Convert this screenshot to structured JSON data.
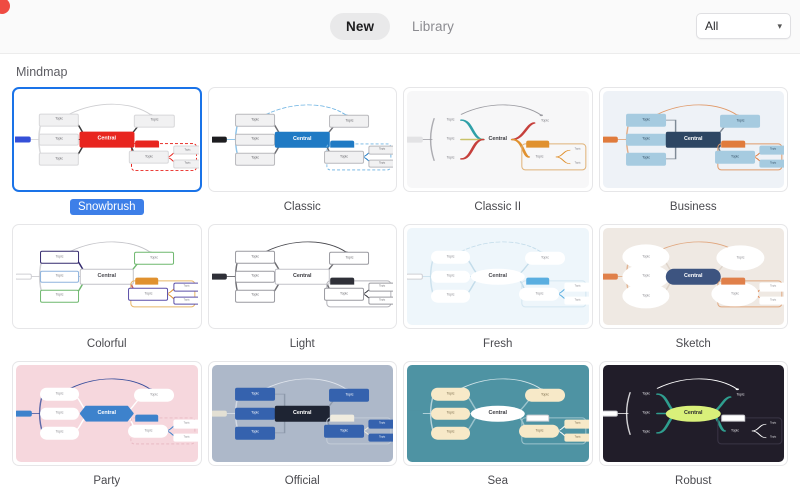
{
  "window": {
    "traffic_light_color": "#ef4b42"
  },
  "header": {
    "tabs": [
      {
        "label": "New",
        "active": true
      },
      {
        "label": "Library",
        "active": false
      }
    ],
    "filter": {
      "value": "All",
      "chevron": "⌄"
    }
  },
  "main": {
    "section_title": "Mindmap",
    "node_labels": {
      "central": "Central",
      "topic": "Topic",
      "sub": "Topic"
    },
    "cards": [
      {
        "name": "Snowbrush",
        "selected": true,
        "bg": "#ffffff",
        "central_bg": "#e8251f",
        "central_fg": "#ffffff",
        "topic_bg": "#f1f1f2",
        "topic_fg": "#6b6b70",
        "topic_border": "#d8d8da",
        "line": "#3a3a3c",
        "accent": "#e8251f",
        "dash": "#cfcfd2",
        "grp_border": "#e8251f",
        "left_chip": "#3550d8"
      },
      {
        "name": "Classic",
        "selected": false,
        "bg": "#ffffff",
        "central_bg": "#1f7ac4",
        "central_fg": "#ffffff",
        "topic_bg": "#f1f1f2",
        "topic_fg": "#5e5e63",
        "topic_border": "#b9b9bd",
        "line": "#6e6e73",
        "accent": "#1f7ac4",
        "dash": "#6fb4e3",
        "grp_border": "#6fb4e3",
        "left_chip": "#1d1d20"
      },
      {
        "name": "Classic II",
        "selected": false,
        "bg": "#f7f7f8",
        "central_bg": "transparent",
        "central_fg": "#3b3b40",
        "topic_bg": "transparent",
        "topic_fg": "#7a7a80",
        "topic_border": "transparent",
        "line": "#9a9aa0",
        "accent": "#e0912f",
        "dash": "#9a9aa0",
        "grp_border": "#e0b277",
        "left_chip": "#e3e3e5",
        "branch_colors": [
          "#2fa0a8",
          "#c9c26a",
          "#c6403c",
          "#e0912f"
        ]
      },
      {
        "name": "Business",
        "selected": false,
        "bg": "#eef2f7",
        "central_bg": "#2d4663",
        "central_fg": "#ffffff",
        "topic_bg": "#a6cbe0",
        "topic_fg": "#2f4a60",
        "topic_border": "transparent",
        "line": "#7e8a96",
        "accent": "#e07b3c",
        "dash": "#e09a6a",
        "grp_border": "#e09a6a",
        "left_chip": "#e07b3c"
      },
      {
        "name": "Colorful",
        "selected": false,
        "bg": "#ffffff",
        "central_bg": "#ffffff",
        "central_fg": "#4a4a50",
        "topic_bg": "#ffffff",
        "topic_fg": "#7a7a80",
        "topic_border": "#5b4fa8",
        "line": "#b0b0b6",
        "accent": "#e0912f",
        "dash": "#c3c3c8",
        "grp_border": "#e8b667",
        "left_chip": "#ffffff",
        "branch_colors": [
          "#342a6e",
          "#8fb4dd",
          "#6fb86f",
          "#d0605c",
          "#e8a13c"
        ]
      },
      {
        "name": "Light",
        "selected": false,
        "bg": "#ffffff",
        "central_bg": "#ffffff",
        "central_fg": "#3b3b40",
        "topic_bg": "#ffffff",
        "topic_fg": "#6b6b70",
        "topic_border": "#9a9aa0",
        "line": "#6e6e73",
        "accent": "#2f3038",
        "dash": "#4a4a50",
        "grp_border": "#b4b4ba",
        "left_chip": "#2f3038"
      },
      {
        "name": "Fresh",
        "selected": false,
        "bg": "#eef6fb",
        "central_bg": "#ffffff",
        "central_fg": "#48484e",
        "topic_bg": "#ffffff",
        "topic_fg": "#8a8a90",
        "topic_border": "transparent",
        "line": "#c3dcea",
        "accent": "#5aaee0",
        "dash": "#c3dcea",
        "grp_border": "#d3e6f1",
        "left_chip": "#ffffff"
      },
      {
        "name": "Sketch",
        "selected": false,
        "bg": "#efe9e3",
        "central_bg": "#3d5480",
        "central_fg": "#ffffff",
        "topic_bg": "#ffffff",
        "topic_fg": "#8a8a90",
        "topic_border": "transparent",
        "line": "#ded4ca",
        "accent": "#e0804a",
        "dash": "#e0a77f",
        "grp_border": "#e0a77f",
        "left_chip": "#e0804a"
      },
      {
        "name": "Party",
        "selected": false,
        "bg": "#f6d7dd",
        "central_bg": "#3d82cc",
        "central_fg": "#ffffff",
        "topic_bg": "#ffffff",
        "topic_fg": "#8a8a90",
        "topic_border": "transparent",
        "line": "#ffffff",
        "accent": "#3d82cc",
        "dash": "#3a4f9c",
        "grp_border": "#e8b8c2",
        "left_chip": "#3d82cc"
      },
      {
        "name": "Official",
        "selected": false,
        "bg": "#adb8c9",
        "central_bg": "#1e2433",
        "central_fg": "#ffffff",
        "topic_bg": "#3562ae",
        "topic_fg": "#ffffff",
        "topic_border": "transparent",
        "line": "#8d99ab",
        "accent": "#f0ecdf",
        "dash": "#dfe4ec",
        "grp_border": "#c3ccd8",
        "left_chip": "#e3e0d4"
      },
      {
        "name": "Sea",
        "selected": false,
        "bg": "#4e93a3",
        "central_bg": "#ffffff",
        "central_fg": "#3b3b40",
        "topic_bg": "#f7e9c8",
        "topic_fg": "#7a6b4a",
        "topic_border": "transparent",
        "line": "#9dc4cd",
        "accent": "#ffffff",
        "dash": "#cfe3e8",
        "grp_border": "#9dc4cd",
        "left_chip": "#4e93a3"
      },
      {
        "name": "Robust",
        "selected": false,
        "bg": "#211d29",
        "central_bg": "#d9f07a",
        "central_fg": "#2a2a2e",
        "topic_bg": "transparent",
        "topic_fg": "#e6e6ea",
        "topic_border": "transparent",
        "line": "#2f9e8f",
        "accent": "#ffffff",
        "dash": "#ffffff",
        "grp_border": "#3a3546",
        "left_chip": "#ffffff"
      }
    ]
  }
}
